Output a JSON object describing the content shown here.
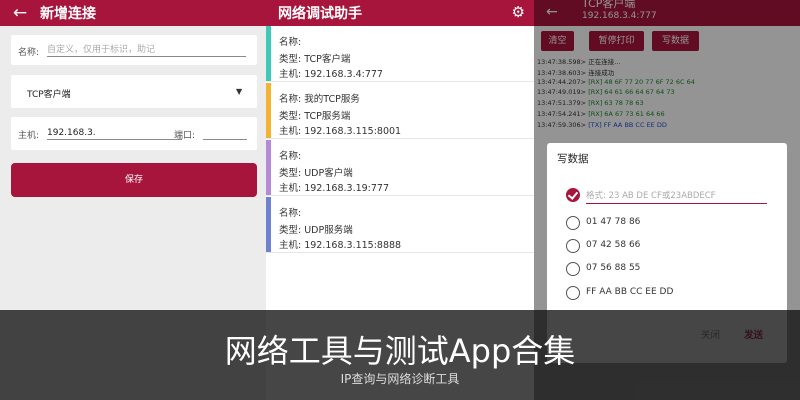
{
  "new_connection": {
    "title": "新增连接",
    "name_label": "名称:",
    "name_placeholder": "自定义，仅用于标识，助记",
    "type_value": "TCP客户端",
    "host_label": "主机:",
    "host_value": "192.168.3.",
    "port_label": "端口:",
    "port_value": "",
    "save_label": "保存"
  },
  "connection_list": {
    "title": "网络调试助手",
    "items": [
      {
        "name_line": "名称:",
        "type_line": "类型: TCP客户端",
        "host_line": "主机: 192.168.3.4:777",
        "color": "#3cc9b8"
      },
      {
        "name_line": "名称: 我的TCP服务",
        "type_line": "类型: TCP服务端",
        "host_line": "主机: 192.168.3.115:8001",
        "color": "#f2b233"
      },
      {
        "name_line": "名称:",
        "type_line": "类型: UDP客户端",
        "host_line": "主机: 192.168.3.19:777",
        "color": "#b48ad6"
      },
      {
        "name_line": "名称:",
        "type_line": "类型: UDP服务端",
        "host_line": "主机: 192.168.3.115:8888",
        "color": "#6f82d0"
      }
    ]
  },
  "session": {
    "title": "TCP客户端",
    "host": "192.168.3.4:777",
    "buttons": [
      "清空",
      "暂停打印",
      "写数据"
    ],
    "log": [
      {
        "time": "13:47:38.598>",
        "text": "正在连接...",
        "kind": "info"
      },
      {
        "time": "13:47:38.603>",
        "text": "连接成功",
        "kind": "info"
      },
      {
        "time": "13:47:44.207>",
        "text": "[RX] 48 6F 77 20 77 6F 72 6C 64",
        "kind": "rx"
      },
      {
        "time": "13:47:49.019>",
        "text": "[RX] 64 61 66 64 67 64 73",
        "kind": "rx"
      },
      {
        "time": "13:47:51.379>",
        "text": "[RX] 63 78 78 63",
        "kind": "rx"
      },
      {
        "time": "13:47:54.241>",
        "text": "[RX] 6A 67 73 61 64 66",
        "kind": "rx"
      },
      {
        "time": "13:47:59.306>",
        "text": "[TX] FF AA BB CC EE DD",
        "kind": "tx"
      }
    ]
  },
  "write_dialog": {
    "title": "写数据",
    "input_placeholder": "格式: 23 AB DE CF或23ABDECF",
    "options": [
      "01 47 78 86",
      "07 42 58 66",
      "07 56 88 55",
      "FF AA BB CC EE DD"
    ],
    "close_label": "关闭",
    "send_label": "发送"
  },
  "banner": {
    "title": "网络工具与测试App合集",
    "subtitle": "IP查询与网络诊断工具"
  },
  "colors": {
    "accent": "#a8153c",
    "rx": "#168a28",
    "tx": "#1d4fd8"
  }
}
